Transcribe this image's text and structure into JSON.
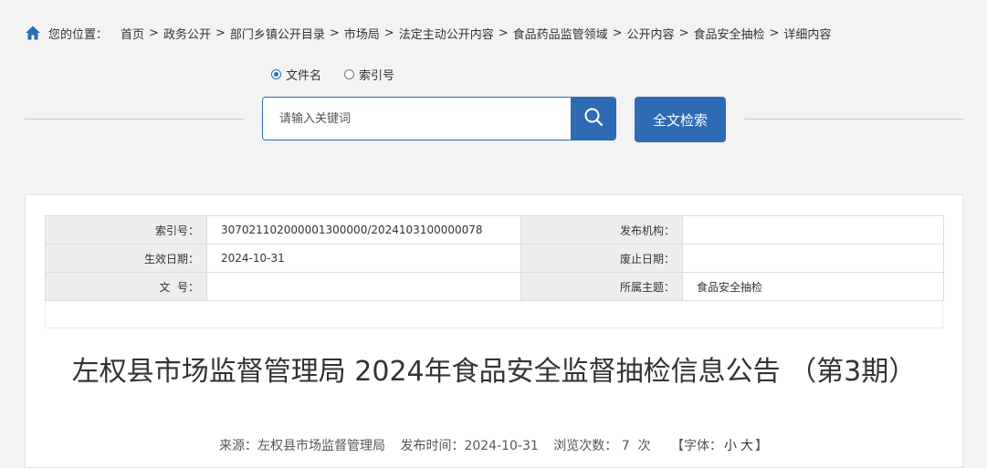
{
  "breadcrumb": {
    "label": "您的位置：",
    "items": [
      "首页",
      "政务公开",
      "部门乡镇公开目录",
      "市场局",
      "法定主动公开内容",
      "食品药品监管领域",
      "公开内容",
      "食品安全抽检",
      "详细内容"
    ]
  },
  "search": {
    "options": [
      "文件名",
      "索引号"
    ],
    "selected": "文件名",
    "placeholder": "请输入关键词",
    "fulltext_label": "全文检索"
  },
  "meta": {
    "index_label": "索引号：",
    "index_value": "307021102000001300000/2024103100000078",
    "publisher_label": "发布机构：",
    "publisher_value": "",
    "effective_label": "生效日期：",
    "effective_value": "2024-10-31",
    "abolish_label": "废止日期：",
    "abolish_value": "",
    "docno_label": "文  号：",
    "docno_value": "",
    "topic_label": "所属主题：",
    "topic_value": "食品安全抽检"
  },
  "article": {
    "title": "左权县市场监督管理局 2024年食品安全监督抽检信息公告 （第3期）",
    "source": "来源：左权县市场监督管理局",
    "publish_time": "发布时间：2024-10-31",
    "views": "浏览次数： 7  次",
    "font_label": "【字体：",
    "font_small": "小",
    "font_large": "大",
    "font_end": "】"
  },
  "colors": {
    "accent": "#2f6bb5",
    "background": "#f3f3f3"
  },
  "icons": {
    "home": "home-icon",
    "search": "search-icon"
  }
}
